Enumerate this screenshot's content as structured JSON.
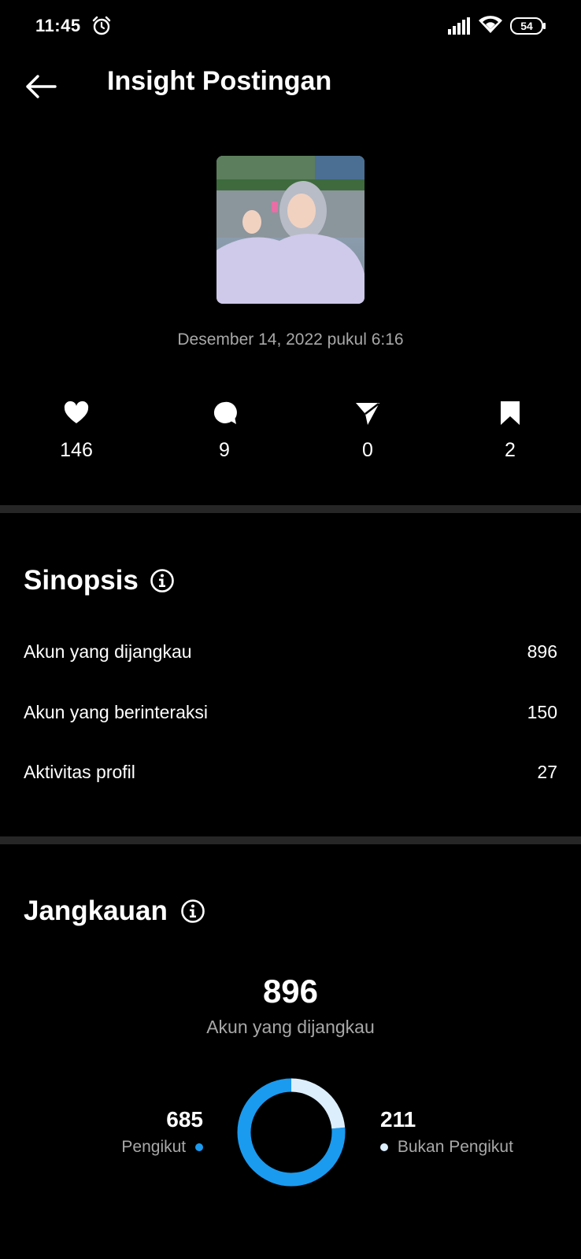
{
  "status_bar": {
    "time": "11:45",
    "battery": "54"
  },
  "header": {
    "title": "Insight Postingan"
  },
  "post": {
    "date": "Desember 14, 2022 pukul 6:16"
  },
  "stats": {
    "likes": "146",
    "comments": "9",
    "shares": "0",
    "saves": "2"
  },
  "sinopsis": {
    "title": "Sinopsis",
    "rows": [
      {
        "label": "Akun yang dijangkau",
        "value": "896"
      },
      {
        "label": "Akun yang berinteraksi",
        "value": "150"
      },
      {
        "label": "Aktivitas profil",
        "value": "27"
      }
    ]
  },
  "jangkauan": {
    "title": "Jangkauan",
    "total": "896",
    "total_label": "Akun yang dijangkau",
    "followers": {
      "value": "685",
      "label": "Pengikut",
      "color": "#1a9bf0"
    },
    "non_followers": {
      "value": "211",
      "label": "Bukan Pengikut",
      "color": "#dceefc"
    }
  }
}
